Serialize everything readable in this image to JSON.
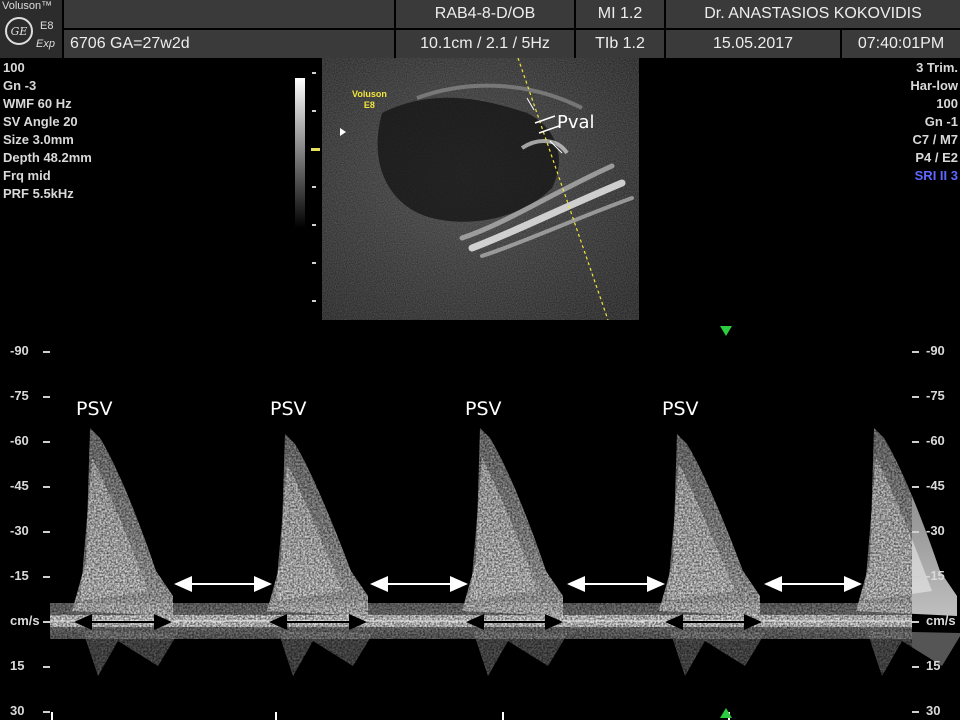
{
  "header": {
    "brand": "Voluson™",
    "logo_text": "GE",
    "model": "E8",
    "model_sub": "Exp",
    "patient_id": "6706  GA=27w2d",
    "probe": "RAB4-8-D/OB",
    "mi": "MI  1.2",
    "doctor": "Dr. ANASTASIOS KOKOVIDIS",
    "depth_freq": "10.1cm / 2.1 /  5Hz",
    "tib": "TIb  1.2",
    "date": "15.05.2017",
    "time": "07:40:01PM"
  },
  "left_params": [
    "100",
    "Gn  -3",
    "WMF 60 Hz",
    "SV Angle 20",
    "Size  3.0mm",
    "Depth 48.2mm",
    "Frq mid",
    "PRF  5.5kHz"
  ],
  "right_params": [
    "3 Trim.",
    "Har-low",
    "100",
    "Gn  -1",
    "C7 / M7",
    "P4 / E2",
    "SRI II 3"
  ],
  "accent_colors": {
    "sri": "#5e67ff",
    "marker": "#2ecc40",
    "cursor": "#f2e63a"
  },
  "image_labels": {
    "bmode_logo_brand": "Voluson",
    "bmode_logo_model": "E8",
    "pval": "Pval",
    "psv": [
      "PSV",
      "PSV",
      "PSV",
      "PSV"
    ]
  },
  "velocity_scale": {
    "unit": "cm/s",
    "labels_left": [
      "-90",
      "-75",
      "-60",
      "-45",
      "-30",
      "-15",
      "cm/s",
      "15",
      "30"
    ],
    "labels_right": [
      "-90",
      "-75",
      "-60",
      "-45",
      "-30",
      "-15",
      "cm/s",
      "15",
      "30"
    ]
  }
}
